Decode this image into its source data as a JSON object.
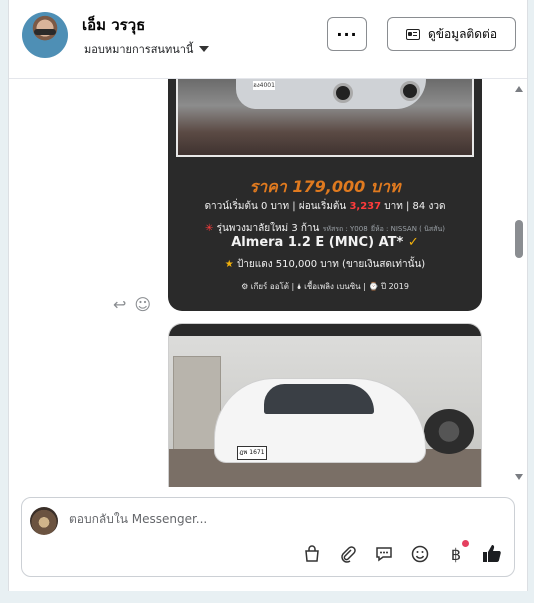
{
  "header": {
    "name": "เอ็ม วรวุธ",
    "assign_label": "มอบหมายการสนทนานี้",
    "more_label": "···",
    "contact_label": "ดูข้อมูลติดต่อ"
  },
  "ad1": {
    "photo_plate": "ฮง4001",
    "price": "ราคา 179,000 บาท",
    "line1_a": "ดาวน์เริ่มต้น 0 บาท | ผ่อนเริ่มต้น ",
    "line1_b": "3,237",
    "line1_c": " บาท | 84 งวด",
    "line2_main": "รุ่นพวงมาลัยใหม่ 3 ก้าน",
    "line2_code": "รหัสรถ : Y008",
    "line2_brand": "ยี่ห้อ : NISSAN ( นิสสัน)",
    "model": "Almera 1.2 E (MNC) AT*",
    "plate_price": "ป้ายแดง 510,000 บาท (ขายเงินสดเท่านั้น)",
    "gear": "เกียร์ ออโต้",
    "fuel": "เชื้อเพลิง เบนซิน",
    "year": "ปี 2019"
  },
  "ad2": {
    "plate": "ฎพ 1671"
  },
  "composer": {
    "placeholder": "ตอบกลับใน Messenger..."
  },
  "icons": [
    "reply-icon",
    "emoji-icon",
    "bag-icon",
    "paperclip-icon",
    "quick-reply-icon",
    "smiley-icon",
    "baht-icon",
    "thumbs-up-icon"
  ]
}
